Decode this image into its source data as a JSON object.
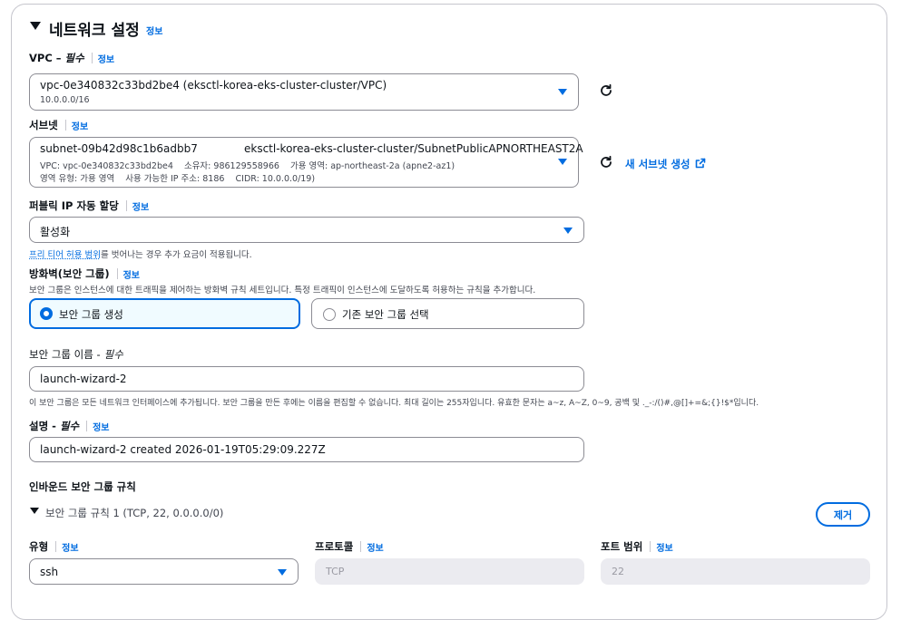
{
  "section": {
    "title": "네트워크 설정",
    "info": "정보"
  },
  "vpc": {
    "label": "VPC –",
    "required": "필수",
    "info": "정보",
    "value": "vpc-0e340832c33bd2be4 (eksctl-korea-eks-cluster-cluster/VPC)",
    "cidr": "10.0.0.0/16"
  },
  "subnet": {
    "label": "서브넷",
    "info": "정보",
    "id": "subnet-09b42d98c1b6adbb7",
    "name": "eksctl-korea-eks-cluster-cluster/SubnetPublicAPNORTHEAST2A",
    "line2": "VPC: vpc-0e340832c33bd2be4    소유자: 986129558966    가용 영역: ap-northeast-2a (apne2-az1)",
    "line3": "영역 유형: 가용 영역    사용 가능한 IP 주소: 8186    CIDR: 10.0.0.0/19)",
    "create_link": "새 서브넷 생성"
  },
  "public_ip": {
    "label": "퍼블릭 IP 자동 할당",
    "info": "정보",
    "value": "활성화",
    "help_link": "프리 티어 허용 범위",
    "help_rest": "를 벗어나는 경우 추가 요금이 적용됩니다."
  },
  "firewall": {
    "label": "방화벽(보안 그룹)",
    "info": "정보",
    "desc": "보안 그룹은 인스턴스에 대한 트래픽을 제어하는 방화벽 규칙 세트입니다. 특정 트래픽이 인스턴스에 도달하도록 허용하는 규칙을 추가합니다.",
    "option_create": "보안 그룹 생성",
    "option_existing": "기존 보안 그룹 선택"
  },
  "sg_name": {
    "label": "보안 그룹 이름 -",
    "required": "필수",
    "value": "launch-wizard-2",
    "help": "이 보안 그룹은 모든 네트워크 인터페이스에 추가됩니다. 보안 그룹을 만든 후에는 이름을 편집할 수 없습니다. 최대 길이는 255자입니다. 유효한 문자는 a~z, A~Z, 0~9, 공백 및 ._-:/()#,@[]+=&;{}!$*입니다."
  },
  "description": {
    "label": "설명 -",
    "required": "필수",
    "info": "정보",
    "value": "launch-wizard-2 created 2026-01-19T05:29:09.227Z"
  },
  "inbound": {
    "title": "인바운드 보안 그룹 규칙",
    "rule_title": "보안 그룹 규칙 1 (TCP, 22, 0.0.0.0/0)",
    "remove_button": "제거",
    "type_label": "유형",
    "type_info": "정보",
    "type_value": "ssh",
    "protocol_label": "프로토콜",
    "protocol_info": "정보",
    "protocol_value": "TCP",
    "port_label": "포트 범위",
    "port_info": "정보",
    "port_value": "22"
  },
  "icons": {
    "section_toggle": "caret-down-icon",
    "refresh": "refresh-icon",
    "external": "external-link-icon"
  },
  "colors": {
    "accent": "#006ce0",
    "border": "#8c8c94",
    "text": "#0f141a",
    "selected_bg": "#f0fbff"
  }
}
